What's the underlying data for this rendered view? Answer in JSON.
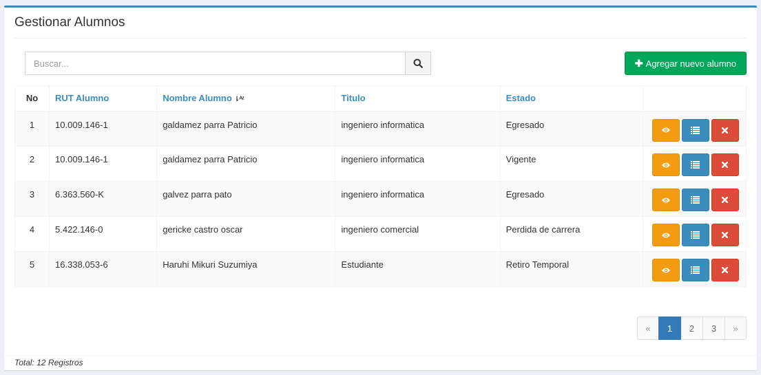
{
  "header": {
    "title": "Gestionar Alumnos"
  },
  "search": {
    "placeholder": "Buscar...",
    "value": "",
    "icon": "search-icon"
  },
  "toolbar": {
    "add_label": "Agregar nuevo alumno",
    "add_icon": "plus-icon"
  },
  "table": {
    "columns": {
      "no": "No",
      "rut": "RUT Alumno",
      "nombre": "Nombre Alumno",
      "titulo": "Titulo",
      "estado": "Estado"
    },
    "sort_icon": "sort-alpha-asc-icon",
    "rows": [
      {
        "no": "1",
        "rut": "10.009.146-1",
        "nombre": "galdamez parra Patricio",
        "titulo": "ingeniero informatica",
        "estado": "Egresado"
      },
      {
        "no": "2",
        "rut": "10.009.146-1",
        "nombre": "galdamez parra Patricio",
        "titulo": "ingeniero informatica",
        "estado": "Vigente"
      },
      {
        "no": "3",
        "rut": "6.363.560-K",
        "nombre": "galvez parra pato",
        "titulo": "ingeniero informatica",
        "estado": "Egresado"
      },
      {
        "no": "4",
        "rut": "5.422.146-0",
        "nombre": "gericke castro oscar",
        "titulo": "ingeniero comercial",
        "estado": "Perdida de carrera"
      },
      {
        "no": "5",
        "rut": "16.338.053-6",
        "nombre": "Haruhi Mikuri Suzumiya",
        "titulo": "Estudiante",
        "estado": "Retiro Temporal"
      }
    ],
    "row_actions": [
      "eye-icon",
      "list-icon",
      "close-icon"
    ]
  },
  "pagination": {
    "prev": "«",
    "pages": [
      "1",
      "2",
      "3"
    ],
    "active": "1",
    "next": "»"
  },
  "footer": {
    "total": "Total: 12 Registros"
  },
  "colors": {
    "primary": "#3c8dbc",
    "success": "#00a65a",
    "warning": "#f39c12",
    "danger": "#dd4b39",
    "page_active": "#337ab7"
  }
}
